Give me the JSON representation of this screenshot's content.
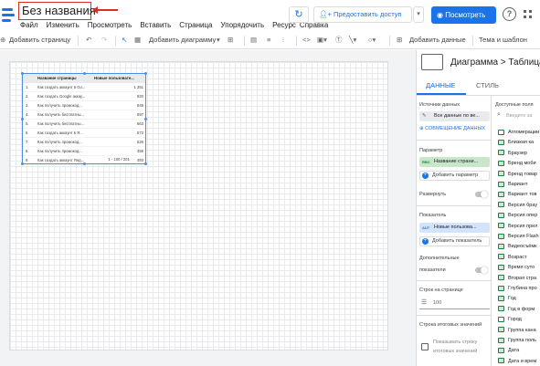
{
  "header": {
    "title": "Без названия",
    "menu": [
      "Файл",
      "Изменить",
      "Просмотреть",
      "Вставить",
      "Страница",
      "Упорядочить",
      "Ресурс",
      "Справка"
    ],
    "refresh_icon": "refresh-icon",
    "share_label": "Предоставить доступ",
    "view_label": "Посмотреть",
    "help_glyph": "?"
  },
  "toolbar": {
    "add_page": "Добавить страницу",
    "add_chart": "Добавить диаграмму",
    "add_data": "Добавить данные",
    "theme": "Тема и шаблон"
  },
  "table": {
    "headers": [
      "Название страницы",
      "Новые пользовате..."
    ],
    "rows": [
      {
        "n": "1.",
        "page": "Как создать аккаунт в Go...",
        "value": "1 351"
      },
      {
        "n": "2.",
        "page": "Как создать Google аккау...",
        "value": "920"
      },
      {
        "n": "3.",
        "page": "Как получить промокод...",
        "value": "849"
      },
      {
        "n": "4.",
        "page": "Как получить бесплатны...",
        "value": "697"
      },
      {
        "n": "5.",
        "page": "Как получить бесплатны...",
        "value": "663"
      },
      {
        "n": "6.",
        "page": "Как создать аккаунт в Я...",
        "value": "573"
      },
      {
        "n": "7.",
        "page": "Как получить промокод...",
        "value": "526"
      },
      {
        "n": "8.",
        "page": "Как получить промокод...",
        "value": "459"
      },
      {
        "n": "9.",
        "page": "Как создать аккаунт Янд...",
        "value": "440"
      }
    ],
    "pager": "1 - 100 / 201"
  },
  "panel": {
    "title": "Диаграмма > Таблица",
    "tab_data": "ДАННЫЕ",
    "tab_style": "СТИЛЬ",
    "data_source_label": "Источник данных",
    "data_source_value": "Все данные по ве...",
    "blend_label": "СОВМЕЩЕНИЕ ДАННЫХ",
    "dimension_label": "Параметр",
    "dimension_value": "Название страни...",
    "add_dimension": "Добавить параметр",
    "expand_label": "Развернуть",
    "metric_label": "Показатель",
    "metric_value": "Новые пользова...",
    "add_metric": "Добавить показатель",
    "extra_metrics_1": "Дополнительные",
    "extra_metrics_2": "показатели",
    "rows_per_page_label": "Строк на странице",
    "rows_per_page_value": "100",
    "summary_label": "Строка итоговых значений",
    "show_summary_1": "Показывать строку",
    "show_summary_2": "итоговых значений",
    "available_fields_label": "Доступные поля",
    "search_placeholder": "Введите за",
    "fields": [
      "Агломерации",
      "Близкая ка",
      "Браузер",
      "Бренд моби",
      "Бренд товар",
      "Вариант",
      "Вариант тов",
      "Версия брау",
      "Версия опер",
      "Версия прил",
      "Версия Flash",
      "Видеосъёмк",
      "Возраст",
      "Время суто",
      "Вторая стра",
      "Глубина про",
      "Год",
      "Год в форм",
      "Город",
      "Группа кана",
      "Группа поль",
      "Дата",
      "Дата и врем"
    ]
  }
}
